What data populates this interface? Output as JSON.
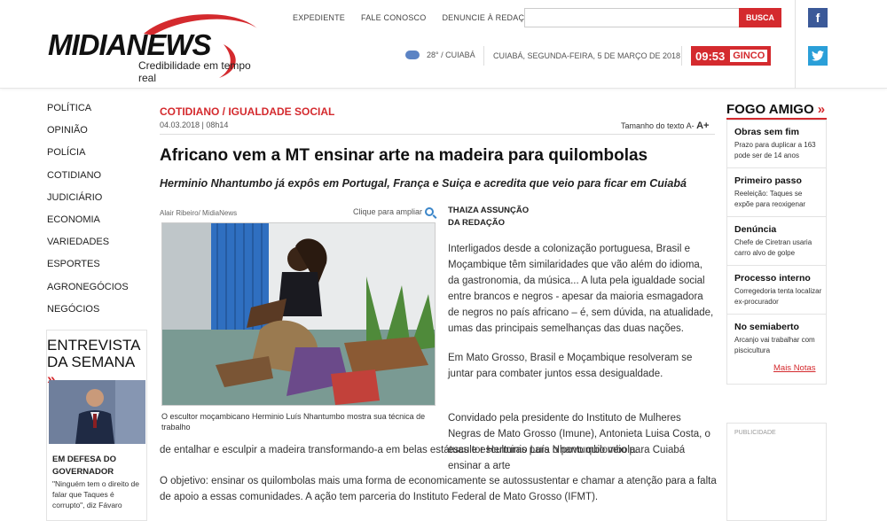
{
  "header": {
    "logo_text": "MIDIANEWS",
    "logo_tagline": "Credibilidade em tempo real",
    "links": [
      "EXPEDIENTE",
      "FALE CONOSCO",
      "DENUNCIE À REDAÇÃO"
    ],
    "search_placeholder": "",
    "search_button": "BUSCA",
    "weather": "28° / CUIABÁ",
    "date": "CUIABÁ, SEGUNDA-FEIRA, 5 DE MARÇO DE 2018",
    "time": "09:53",
    "sponsor": "GINCO",
    "social": {
      "facebook": "f",
      "twitter": "t"
    }
  },
  "nav": [
    "POLÍTICA",
    "OPINIÃO",
    "POLÍCIA",
    "COTIDIANO",
    "JUDICIÁRIO",
    "ECONOMIA",
    "VARIEDADES",
    "ESPORTES",
    "AGRONEGÓCIOS",
    "NEGÓCIOS"
  ],
  "entrevista": {
    "title_line1": "ENTREVISTA",
    "title_line2": "DA SEMANA",
    "chevron": "»",
    "heading": "EM DEFESA DO GOVERNADOR",
    "quote": "\"Ninguém tem o direito de falar que Taques é corrupto\", diz Fávaro"
  },
  "article": {
    "category": "COTIDIANO / IGUALDADE SOCIAL",
    "meta": "04.03.2018 | 08h14",
    "text_size_label": "Tamanho do texto",
    "text_size_minus": "A-",
    "text_size_plus": "A+",
    "title": "Africano vem a MT ensinar arte na madeira para quilombolas",
    "subtitle": "Herminio Nhantumbo já expôs em Portugal, França e Suiça e acredita que veio para ficar em Cuiabá",
    "photo_credit": "Alair Ribeiro/ MidiaNews",
    "zoom_label": "Clique para ampliar",
    "caption": "O escultor moçambicano Herminio Luís Nhantumbo mostra sua técnica de trabalho",
    "author_line1": "THAIZA ASSUNÇÃO",
    "author_line2": "DA REDAÇÃO",
    "p1": "Interligados desde a colonização portuguesa, Brasil e Moçambique têm similaridades que vão além do idioma, da gastronomia, da música... A luta pela igualdade social entre brancos e negros - apesar da maioria esmagadora de negros no país africano – é, sem dúvida, na atualidade, umas das principais semelhanças das duas nações.",
    "p2": "Em Mato Grosso, Brasil e Moçambique resolveram se juntar para combater juntos essa desigualdade.",
    "p3a": "Convidado pela presidente do Instituto de Mulheres Negras de Mato Grosso (Imune), Antonieta Luisa Costa, o escultor Herminio Luís Nhantumbo veio para Cuiabá ensinar a arte",
    "p3b": "de entalhar e esculpir a madeira transformando-a em belas estátuas e esculturas para o povo quilombola.",
    "p4": "O objetivo: ensinar os quilombolas mais uma forma de economicamente se autossustentar e chamar a atenção para a falta de apoio a essas comunidades.  A ação tem parceria do Instituto Federal de Mato Grosso (IFMT)."
  },
  "sidebar": {
    "title": "FOGO AMIGO",
    "chevron": "»",
    "items": [
      {
        "heading": "Obras sem fim",
        "text": "Prazo para duplicar a 163 pode ser de 14 anos"
      },
      {
        "heading": "Primeiro passo",
        "text": "Reeleição: Taques se expõe para reoxigenar"
      },
      {
        "heading": "Denúncia",
        "text": "Chefe de Ciretran usaria carro alvo de golpe"
      },
      {
        "heading": "Processo interno",
        "text": "Corregedoria tenta localizar ex-procurador"
      },
      {
        "heading": "No semiaberto",
        "text": "Arcanjo vai trabalhar com piscicultura"
      }
    ],
    "more_label": "Mais Notas",
    "ad_label": "PUBLICIDADE"
  },
  "colors": {
    "accent": "#d42a2e",
    "facebook": "#3b5998",
    "twitter": "#2a9fd8"
  }
}
